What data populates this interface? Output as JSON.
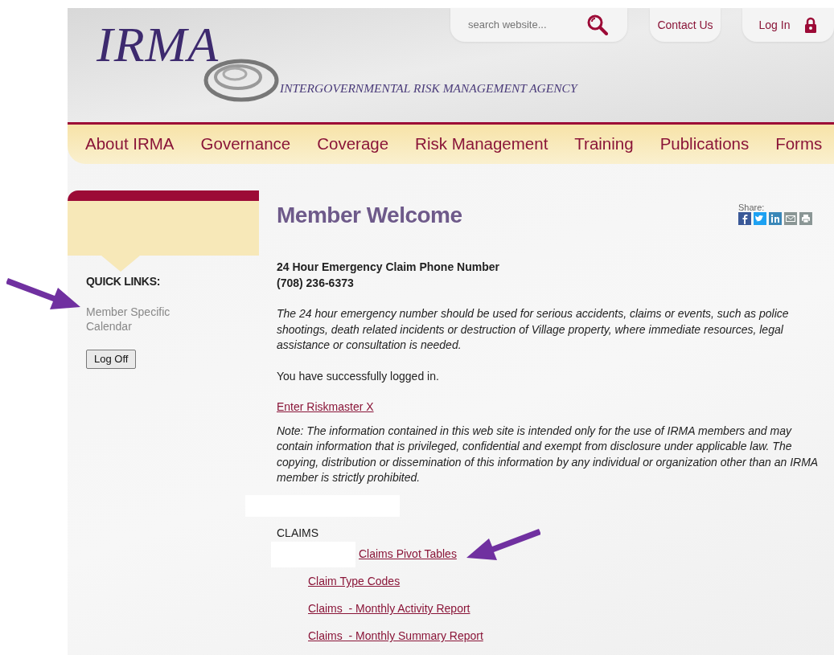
{
  "header": {
    "logo_title": "IRMA",
    "logo_subtitle": "INTERGOVERNMENTAL RISK MANAGEMENT AGENCY",
    "search": {
      "placeholder": "search website..."
    },
    "top_links": [
      "Contact Us",
      "Log In"
    ],
    "nav": [
      "About IRMA",
      "Governance",
      "Coverage",
      "Risk Management",
      "Training",
      "Publications",
      "Forms"
    ]
  },
  "sidebar": {
    "heading": "QUICK LINKS:",
    "links": [
      "Member Specific Calendar"
    ],
    "button": "Log Off"
  },
  "main": {
    "title": "Member Welcome",
    "share_label": "Share:",
    "emergency_heading": "24 Hour Emergency Claim Phone Number",
    "emergency_phone": "(708) 236-6373",
    "emergency_note": "The 24 hour emergency number should be used for serious accidents, claims or events, such as police shootings, death related incidents or destruction of Village property, where immediate resources, legal assistance or consultation is needed.",
    "status": "You have successfully logged in.",
    "riskmaster_link": "Enter Riskmaster X",
    "disclaimer": "Note: The information contained in this web site is intended only for the use of IRMA members and may contain information that is privileged, confidential and exempt from disclosure under applicable law. The copying, distribution or dissemination of this information by any individual or organization other than an IRMA member is strictly prohibited.",
    "claims_heading": "CLAIMS",
    "claims_links": [
      {
        "label": "Claims Pivot Tables",
        "redacted_prefix": true
      },
      {
        "label": "Claim Type Codes",
        "redacted_prefix": false
      },
      {
        "label": "Claims  - Monthly Activity Report",
        "redacted_prefix": false
      },
      {
        "label": "Claims  - Monthly Summary Report",
        "redacted_prefix": false
      }
    ]
  }
}
